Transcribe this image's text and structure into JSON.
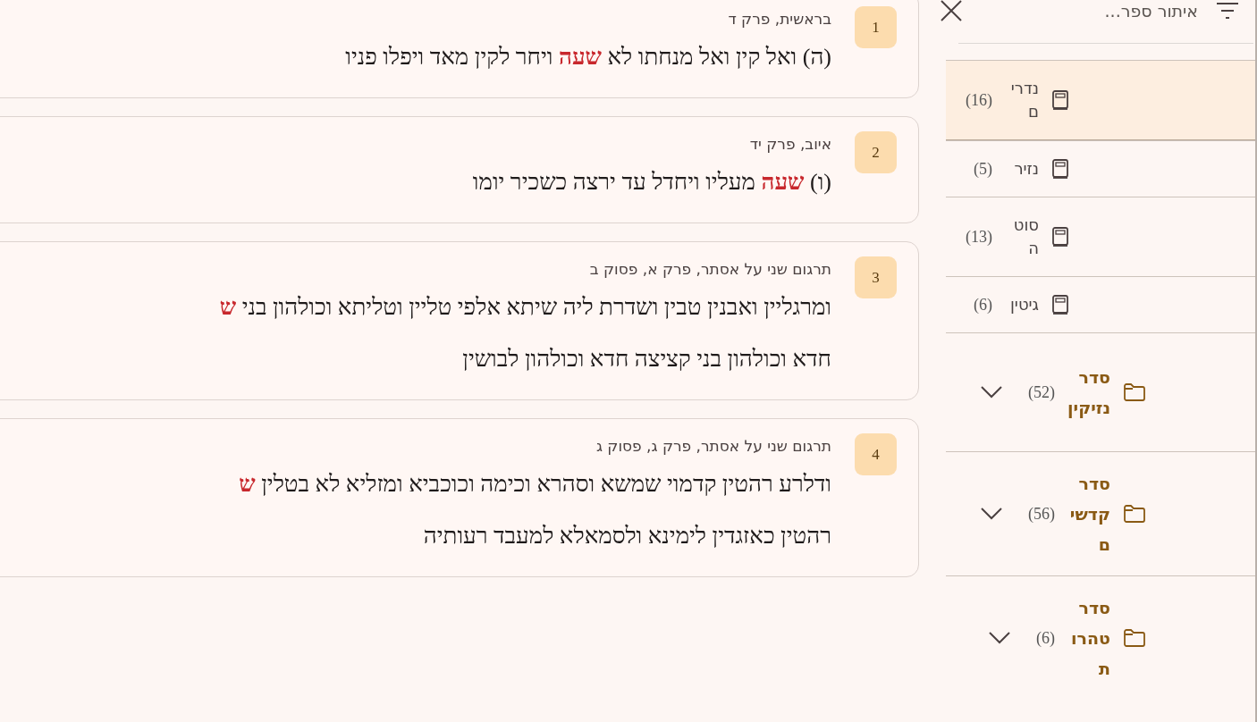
{
  "results": [
    {
      "number": "1",
      "reference": "בראשית, פרק ד",
      "lines": [
        "(ה) ואל קין ואל מנחתו לא **שעה** ויחר לקין מאד ויפלו פניו"
      ]
    },
    {
      "number": "2",
      "reference": "איוב, פרק יד",
      "lines": [
        "(ו) **שעה** מעליו ויחדל עד ירצה כשכיר יומו"
      ]
    },
    {
      "number": "3",
      "reference": "תרגום שני על אסתר, פרק א, פסוק ב",
      "lines": [
        "ומרגליין ואבנין טבין ושדרת ליה שיתא אלפי טליין וטליתא וכולהון בני **ש**",
        "חדא וכולהון בני קציצה חדא וכולהון לבושין"
      ]
    },
    {
      "number": "4",
      "reference": "תרגום שני על אסתר, פרק ג, פסוק ג",
      "lines": [
        "ודלרע רהטין קדמוי שמשא וסהרא וכימה וכוכביא ומזליא לא בטלין **ש**",
        "רהטין כאזגדין לימינא ולסמאלא למעבד רעותיה"
      ]
    }
  ],
  "sidebar": {
    "search": {
      "placeholder": "איתור ספר..."
    },
    "items": [
      {
        "kind": "book",
        "name": "נדרים",
        "count": "(16)",
        "selected": true
      },
      {
        "kind": "book",
        "name": "נזיר",
        "count": "(5)",
        "selected": false
      },
      {
        "kind": "book",
        "name": "סוטה",
        "count": "(13)",
        "selected": false
      },
      {
        "kind": "book",
        "name": "גיטין",
        "count": "(6)",
        "selected": false
      },
      {
        "kind": "folder",
        "name": "סדר נזיקין",
        "count": "(52)",
        "selected": false,
        "expanded": false
      },
      {
        "kind": "folder",
        "name": "סדר קדשים",
        "count": "(56)",
        "selected": false,
        "expanded": false
      },
      {
        "kind": "folder",
        "name": "סדר טהרות",
        "count": "(6)",
        "selected": false,
        "expanded": false
      }
    ]
  }
}
